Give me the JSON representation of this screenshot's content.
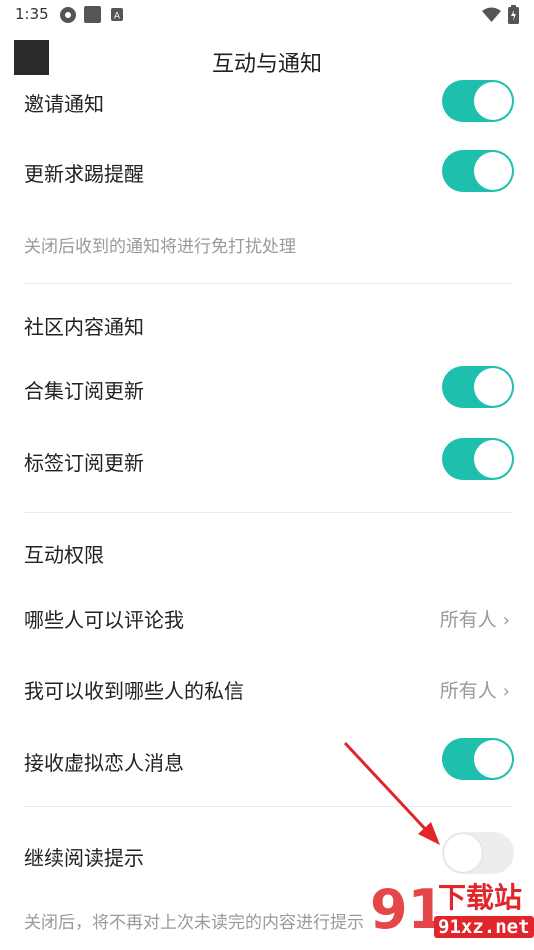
{
  "status": {
    "time": "1:35"
  },
  "header": {
    "title": "互动与通知"
  },
  "items": {
    "invite": "邀请通知",
    "update": "更新求踢提醒",
    "note1": "关闭后收到的通知将进行免打扰处理",
    "community": "社区内容通知",
    "collection": "合集订阅更新",
    "tag": "标签订阅更新",
    "permissions": "互动权限",
    "comment": "哪些人可以评论我",
    "comment_value": "所有人",
    "dm": "我可以收到哪些人的私信",
    "dm_value": "所有人",
    "virtual": "接收虚拟恋人消息",
    "continue": "继续阅读提示",
    "note2": "关闭后，将不再对上次未读完的内容进行提示"
  },
  "toggles": {
    "invite": true,
    "update": true,
    "collection": true,
    "tag": true,
    "virtual": true,
    "continue": false
  },
  "watermark": {
    "brand": "下载站",
    "site": "91xz.net"
  },
  "colors": {
    "accent": "#1fbfae",
    "arrow": "#e0262a"
  }
}
